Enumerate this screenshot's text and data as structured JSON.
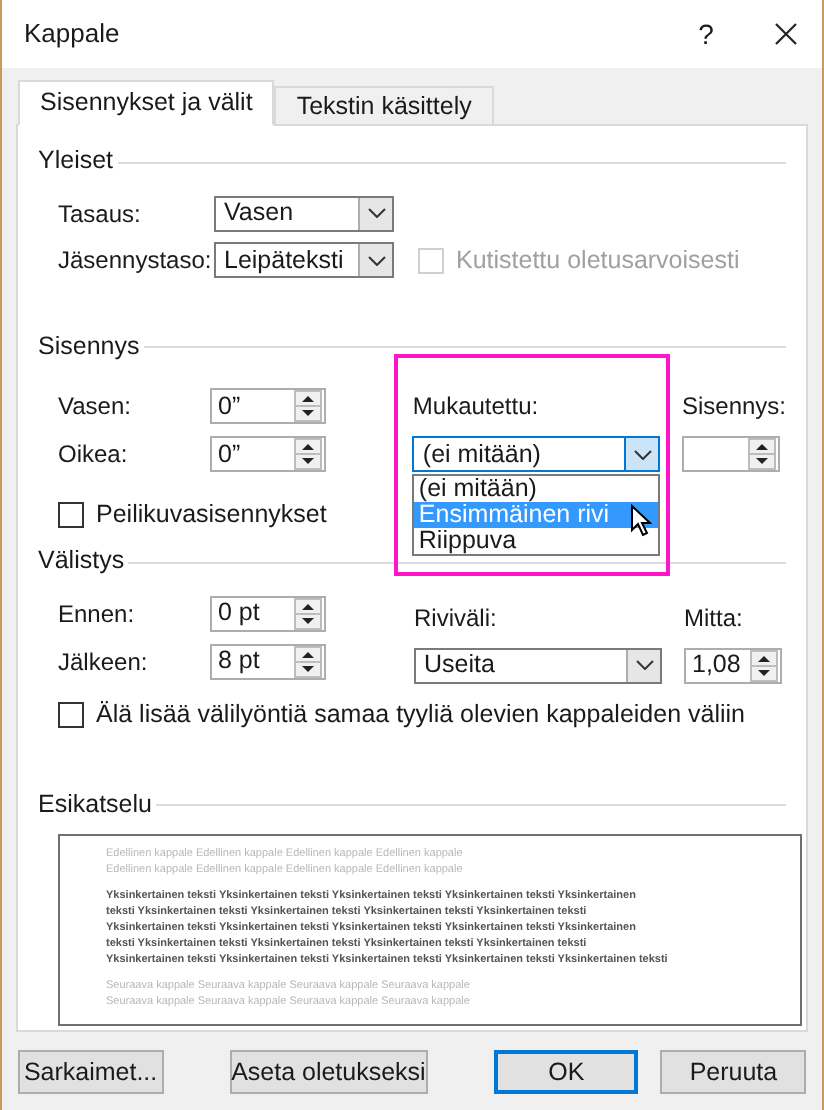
{
  "window": {
    "title": "Kappale",
    "help": "?"
  },
  "tabs": [
    {
      "label": "Sisennykset ja välit",
      "selected": true
    },
    {
      "label": "Tekstin käsittely",
      "selected": false
    }
  ],
  "general": {
    "title": "Yleiset",
    "alignment": {
      "label": "Tasaus:",
      "value": "Vasen"
    },
    "outline_level": {
      "label": "Jäsennystaso:",
      "value": "Leipäteksti"
    },
    "collapsed": {
      "label": "Kutistettu oletusarvoisesti",
      "checked": false,
      "disabled": true
    }
  },
  "indentation": {
    "title": "Sisennys",
    "left": {
      "label": "Vasen:",
      "value": "0”"
    },
    "right": {
      "label": "Oikea:",
      "value": "0”"
    },
    "special": {
      "label": "Mukautettu:",
      "value": "(ei mitään)",
      "expanded": true,
      "options": [
        {
          "label": "(ei mitään)",
          "highlighted": false
        },
        {
          "label": "Ensimmäinen rivi",
          "highlighted": true
        },
        {
          "label": "Riippuva",
          "highlighted": false
        }
      ]
    },
    "by": {
      "label": "Sisennys:"
    },
    "mirror": {
      "label": "Peilikuvasisennykset",
      "checked": false
    }
  },
  "spacing": {
    "title": "Välistys",
    "before": {
      "label": "Ennen:",
      "value": "0 pt"
    },
    "after": {
      "label": "Jälkeen:",
      "value": "8 pt"
    },
    "line_spacing": {
      "label": "Riviväli:",
      "value": "Useita"
    },
    "at": {
      "label": "Mitta:",
      "value": "1,08"
    },
    "dont_add": {
      "label": "Älä lisää välilyöntiä samaa tyyliä olevien kappaleiden väliin",
      "checked": false
    }
  },
  "preview": {
    "title": "Esikatselu",
    "lines": [
      {
        "kind": "previous",
        "text": "Edellinen kappale Edellinen kappale Edellinen kappale Edellinen kappale"
      },
      {
        "kind": "previous",
        "text": "Edellinen kappale Edellinen kappale Edellinen kappale Edellinen kappale"
      },
      {
        "kind": "current",
        "text": "Yksinkertainen teksti Yksinkertainen teksti Yksinkertainen teksti Yksinkertainen teksti Yksinkertainen"
      },
      {
        "kind": "current",
        "text": "teksti Yksinkertainen teksti Yksinkertainen teksti Yksinkertainen teksti Yksinkertainen teksti"
      },
      {
        "kind": "current",
        "text": "Yksinkertainen teksti Yksinkertainen teksti Yksinkertainen teksti Yksinkertainen teksti Yksinkertainen"
      },
      {
        "kind": "current",
        "text": "teksti Yksinkertainen teksti Yksinkertainen teksti Yksinkertainen teksti Yksinkertainen teksti"
      },
      {
        "kind": "current",
        "text": "Yksinkertainen teksti Yksinkertainen teksti Yksinkertainen teksti Yksinkertainen teksti Yksinkertainen teksti"
      },
      {
        "kind": "next",
        "text": "Seuraava kappale Seuraava kappale Seuraava kappale Seuraava kappale"
      },
      {
        "kind": "next",
        "text": "Seuraava kappale Seuraava kappale Seuraava kappale Seuraava kappale"
      }
    ]
  },
  "buttons": [
    {
      "label": "Sarkaimet...",
      "default": false
    },
    {
      "label": "Aseta oletukseksi",
      "default": false
    },
    {
      "label": "OK",
      "default": true
    },
    {
      "label": "Peruuta",
      "default": false
    }
  ]
}
